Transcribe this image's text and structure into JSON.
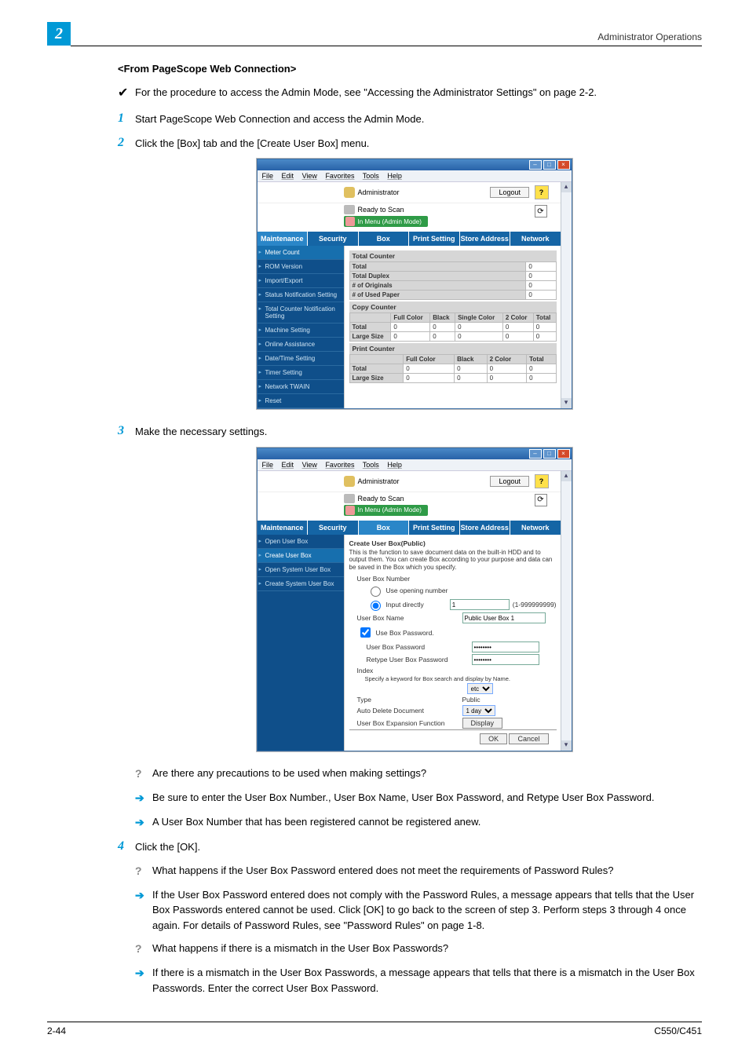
{
  "page": {
    "chapter_tab": "2",
    "header_right": "Administrator Operations",
    "footer_left": "2-44",
    "footer_right": "C550/C451"
  },
  "section_title": "<From PageScope Web Connection>",
  "check1": "For the procedure to access the Admin Mode, see \"Accessing the Administrator Settings\" on page 2-2.",
  "steps": {
    "s1": "Start PageScope Web Connection and access the Admin Mode.",
    "s2": "Click the [Box] tab and the [Create User Box] menu.",
    "s3": "Make the necessary settings.",
    "s4": "Click the [OK]."
  },
  "qa": {
    "q1": "Are there any precautions to be used when making settings?",
    "a1": "Be sure to enter the User Box Number., User Box Name, User Box Password, and Retype User Box Password.",
    "a2": "A User Box Number that has been registered cannot be registered anew.",
    "q3": "What happens if the User Box Password entered does not meet the requirements of Password Rules?",
    "a3": "If the User Box Password entered does not comply with the Password Rules, a message appears that tells that the User Box Passwords entered cannot be used. Click [OK] to go back to the screen of step 3. Perform steps 3 through 4 once again. For details of Password Rules, see \"Password Rules\" on page 1-8.",
    "q4": "What happens if there is a mismatch in the User Box Passwords?",
    "a4": "If there is a mismatch in the User Box Passwords, a message appears that tells that there is a mismatch in the User Box Passwords. Enter the correct User Box Password."
  },
  "browser": {
    "menus": [
      "File",
      "Edit",
      "View",
      "Favorites",
      "Tools",
      "Help"
    ],
    "admin_label": "Administrator",
    "logout": "Logout",
    "status1": "Ready to Scan",
    "status2": "In Menu (Admin Mode)",
    "tabs": [
      "Maintenance",
      "Security",
      "Box",
      "Print Setting",
      "Store Address",
      "Network"
    ]
  },
  "shot1": {
    "side": [
      "Meter Count",
      "ROM Version",
      "Import/Export",
      "Status Notification Setting",
      "Total Counter Notification Setting",
      "Machine Setting",
      "Online Assistance",
      "Date/Time Setting",
      "Timer Setting",
      "Network TWAIN",
      "Reset"
    ],
    "grp1_title": "Total Counter",
    "grp1_rows": [
      {
        "k": "Total",
        "v": "0"
      },
      {
        "k": "Total Duplex",
        "v": "0"
      },
      {
        "k": "# of Originals",
        "v": "0"
      },
      {
        "k": "# of Used Paper",
        "v": "0"
      }
    ],
    "grp2_title": "Copy Counter",
    "grp2_head": [
      "",
      "Full Color",
      "Black",
      "Single Color",
      "2 Color",
      "Total"
    ],
    "grp2_rows": [
      [
        "Total",
        "0",
        "0",
        "0",
        "0",
        "0"
      ],
      [
        "Large Size",
        "0",
        "0",
        "0",
        "0",
        "0"
      ]
    ],
    "grp3_title": "Print Counter",
    "grp3_head": [
      "",
      "Full Color",
      "Black",
      "2 Color",
      "Total"
    ],
    "grp3_rows": [
      [
        "Total",
        "0",
        "0",
        "0",
        "0"
      ],
      [
        "Large Size",
        "0",
        "0",
        "0",
        "0"
      ]
    ]
  },
  "shot2": {
    "side": [
      "Open User Box",
      "Create User Box",
      "Open System User Box",
      "Create System User Box"
    ],
    "title": "Create User Box(Public)",
    "note": "This is the function to save document data on the built-in HDD and to output them. You can create Box according to your purpose and data can be saved in the Box which you specify.",
    "labels": {
      "num_group": "User Box Number",
      "opt_opening": "Use opening number",
      "opt_direct": "Input directly",
      "direct_value": "1",
      "direct_range": "(1-999999999)",
      "name": "User Box Name",
      "name_value": "Public User Box 1",
      "use_pw": "Use Box Password.",
      "pw": "User Box Password",
      "pw2": "Retype User Box Password",
      "index": "Index",
      "index_note": "Specify a keyword for Box search and display by Name.",
      "index_value": "etc",
      "type": "Type",
      "type_value": "Public",
      "auto_del": "Auto Delete Document",
      "auto_del_value": "1 day",
      "expand": "User Box Expansion Function",
      "display_btn": "Display",
      "ok": "OK",
      "cancel": "Cancel"
    }
  }
}
